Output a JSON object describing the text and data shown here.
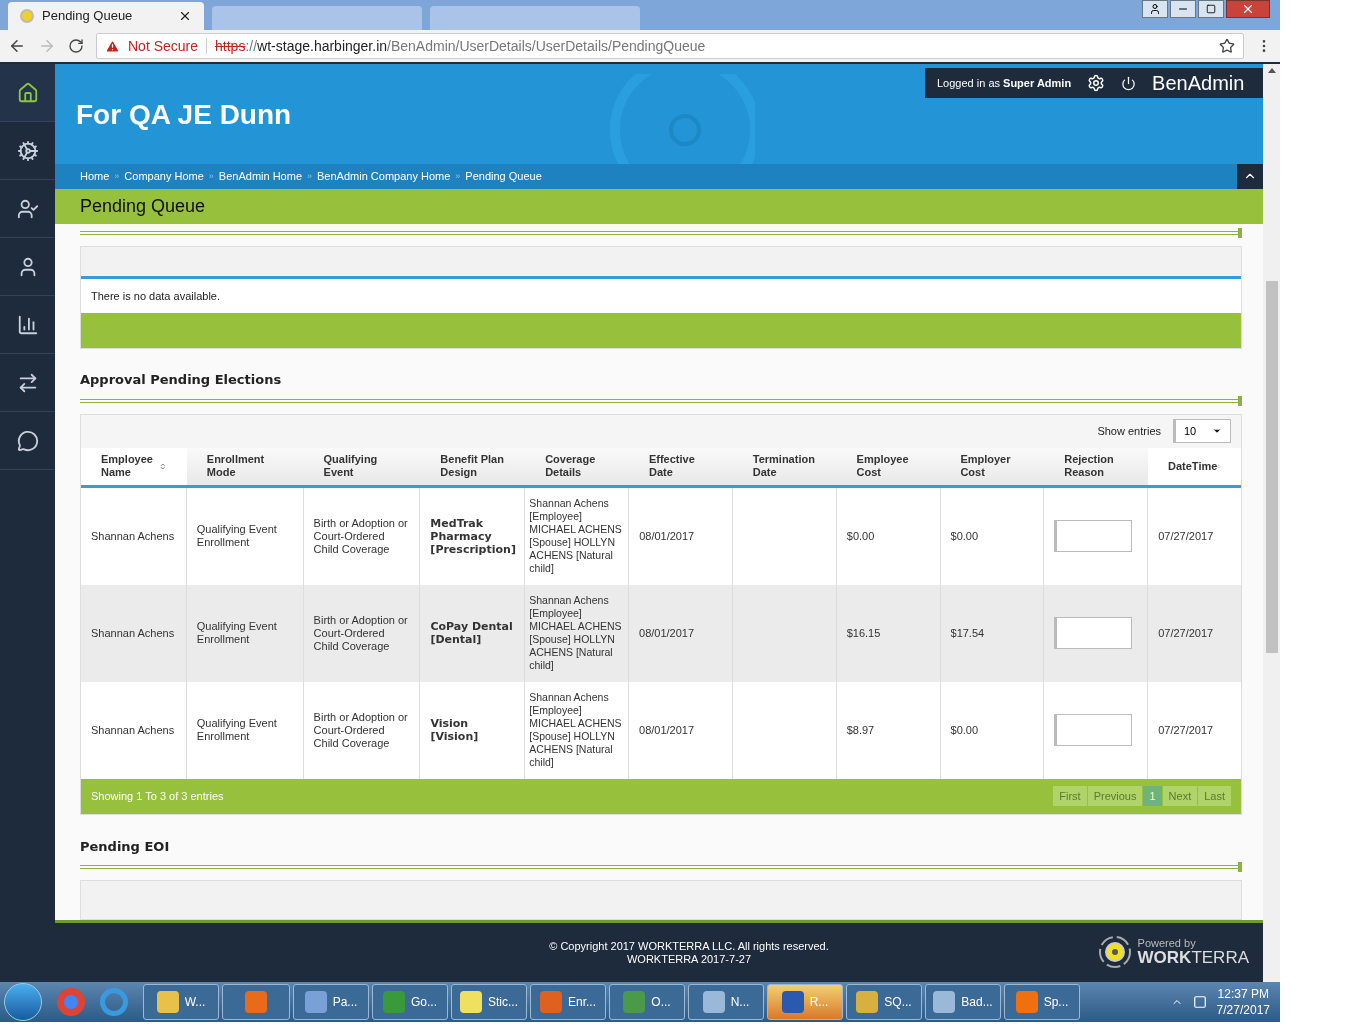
{
  "browser": {
    "tabs": [
      {
        "title": "Pending Queue",
        "selected": true
      },
      {
        "selected": false
      },
      {
        "selected": false
      }
    ],
    "security": "Not Secure",
    "scheme": "https",
    "separator": "://",
    "host": "wt-stage.harbinger.in",
    "path": "/BenAdmin/UserDetails/UserDetails/PendingQueue"
  },
  "sidebar": {
    "items": [
      {
        "selected": true
      },
      {
        "selected": false
      },
      {
        "selected": false
      },
      {
        "selected": false
      },
      {
        "selected": false
      },
      {
        "selected": false
      },
      {
        "selected": false
      }
    ]
  },
  "header": {
    "company": "For QA JE Dunn",
    "user_label": "Logged in as **Super Admin**",
    "app_name": "BenAdmin"
  },
  "breadcrumb_separator": "»",
  "breadcrumbs": [
    "Home",
    "Company Home",
    "BenAdmin Home",
    "BenAdmin Company Home",
    "Pending Queue"
  ],
  "page_title": "Pending Queue",
  "queue_panel": {
    "empty_message": "There is no data available."
  },
  "approval": {
    "title": "Approval Pending Elections",
    "show_entries_label": "Show entries",
    "page_size": "10",
    "columns": [
      {
        "label": "Employee Name",
        "sortable": true,
        "kind": "text"
      },
      {
        "label": "Enrollment Mode",
        "sortable": false,
        "kind": "text"
      },
      {
        "label": "Qualifying Event",
        "sortable": false,
        "kind": "text"
      },
      {
        "label": "Benefit Plan Design",
        "sortable": false,
        "kind": "bold"
      },
      {
        "label": "Coverage Details",
        "sortable": false,
        "kind": "text"
      },
      {
        "label": "Effective Date",
        "sortable": false,
        "kind": "text"
      },
      {
        "label": "Termination Date",
        "sortable": false,
        "kind": "text"
      },
      {
        "label": "Employee Cost",
        "sortable": false,
        "kind": "text"
      },
      {
        "label": "Employer Cost",
        "sortable": false,
        "kind": "text"
      },
      {
        "label": "Rejection Reason",
        "sortable": false,
        "kind": "input"
      },
      {
        "label": "DateTime",
        "sortable": true,
        "kind": "text"
      }
    ],
    "rows": [
      {
        "cells": [
          "Shannan Achens",
          "Qualifying Event Enrollment",
          "Birth or Adoption or Court-Ordered Child Coverage",
          "MedTrak Pharmacy [Prescription]",
          "Shannan Achens [Employee] MICHAEL ACHENS [Spouse] HOLLYN ACHENS [Natural child]",
          "08/01/2017",
          null,
          "$0.00",
          "$0.00",
          null,
          "07/27/2017"
        ]
      },
      {
        "cells": [
          "Shannan Achens",
          "Qualifying Event Enrollment",
          "Birth or Adoption or Court-Ordered Child Coverage",
          "CoPay Dental [Dental]",
          "Shannan Achens [Employee] MICHAEL ACHENS [Spouse] HOLLYN ACHENS [Natural child]",
          "08/01/2017",
          null,
          "$16.15",
          "$17.54",
          null,
          "07/27/2017"
        ]
      },
      {
        "cells": [
          "Shannan Achens",
          "Qualifying Event Enrollment",
          "Birth or Adoption or Court-Ordered Child Coverage",
          "Vision [Vision]",
          "Shannan Achens [Employee] MICHAEL ACHENS [Spouse] HOLLYN ACHENS [Natural child]",
          "08/01/2017",
          null,
          "$8.97",
          "$0.00",
          null,
          "07/27/2017"
        ]
      }
    ],
    "info": "Showing 1 To 3 of 3 entries",
    "pagination": [
      {
        "label": "First",
        "selected": false,
        "disabled": true
      },
      {
        "label": "Previous",
        "selected": false,
        "disabled": true
      },
      {
        "label": "1",
        "selected": true,
        "disabled": false
      },
      {
        "label": "Next",
        "selected": false,
        "disabled": true
      },
      {
        "label": "Last",
        "selected": false,
        "disabled": true
      }
    ]
  },
  "pending_eoi": {
    "title": "Pending EOI"
  },
  "footer": {
    "copyright": "© Copyright 2017 WORKTERRA LLC. All rights reserved.",
    "version": "WORKTERRA 2017-7-27",
    "powered_by": "Powered by",
    "brand": "**WORK**TERRA"
  },
  "taskbar": {
    "items": [
      {
        "label": "W...",
        "selected": false
      },
      {
        "selected": false
      },
      {
        "label": "Pa...",
        "selected": false
      },
      {
        "label": "Go...",
        "selected": false
      },
      {
        "label": "Stic...",
        "selected": false
      },
      {
        "label": "Enr...",
        "selected": false
      },
      {
        "label": "O...",
        "selected": false
      },
      {
        "label": "N...",
        "selected": false
      },
      {
        "label": "R...",
        "selected": true
      },
      {
        "label": "SQ...",
        "selected": false
      },
      {
        "label": "Bad...",
        "selected": false
      },
      {
        "label": "Sp...",
        "selected": false
      }
    ],
    "time": "12:37 PM",
    "date": "7/27/2017"
  }
}
